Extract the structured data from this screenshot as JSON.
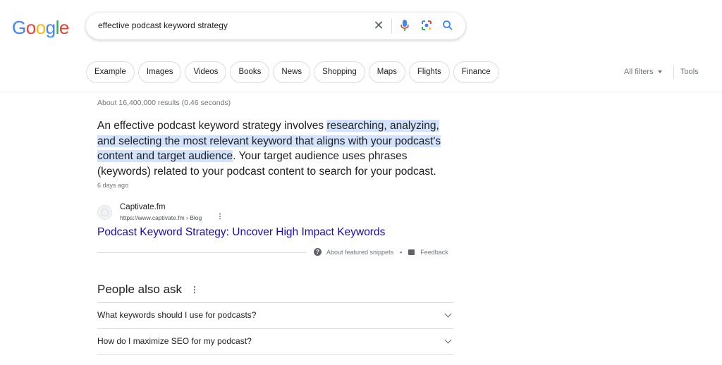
{
  "logo": {
    "letters": [
      "G",
      "o",
      "o",
      "g",
      "l",
      "e"
    ],
    "colors": [
      "#4285f4",
      "#ea4335",
      "#fbbc05",
      "#4285f4",
      "#34a853",
      "#ea4335"
    ]
  },
  "search": {
    "query": "effective podcast keyword strategy"
  },
  "chips": [
    "Example",
    "Images",
    "Videos",
    "Books",
    "News",
    "Shopping",
    "Maps",
    "Flights",
    "Finance"
  ],
  "toolbar": {
    "all_filters": "All filters",
    "tools": "Tools"
  },
  "results": {
    "stats": "About 16,400,000 results (0.46 seconds)",
    "snippet": {
      "before": "An effective podcast keyword strategy involves ",
      "highlight": "researching, analyzing, and selecting the most relevant keyword that aligns with your podcast's content and target audience",
      "after": ". Your target audience uses phrases (keywords) related to your podcast content to search for your podcast.",
      "date": "6 days ago"
    },
    "source": {
      "site_name": "Captivate.fm",
      "url": "https://www.captivate.fm › Blog"
    },
    "title": "Podcast Keyword Strategy: Uncover High Impact Keywords",
    "about_snippets": "About featured snippets",
    "feedback": "Feedback"
  },
  "people_also_ask": {
    "title": "People also ask",
    "questions": [
      "What keywords should I use for podcasts?",
      "How do I maximize SEO for my podcast?"
    ]
  }
}
